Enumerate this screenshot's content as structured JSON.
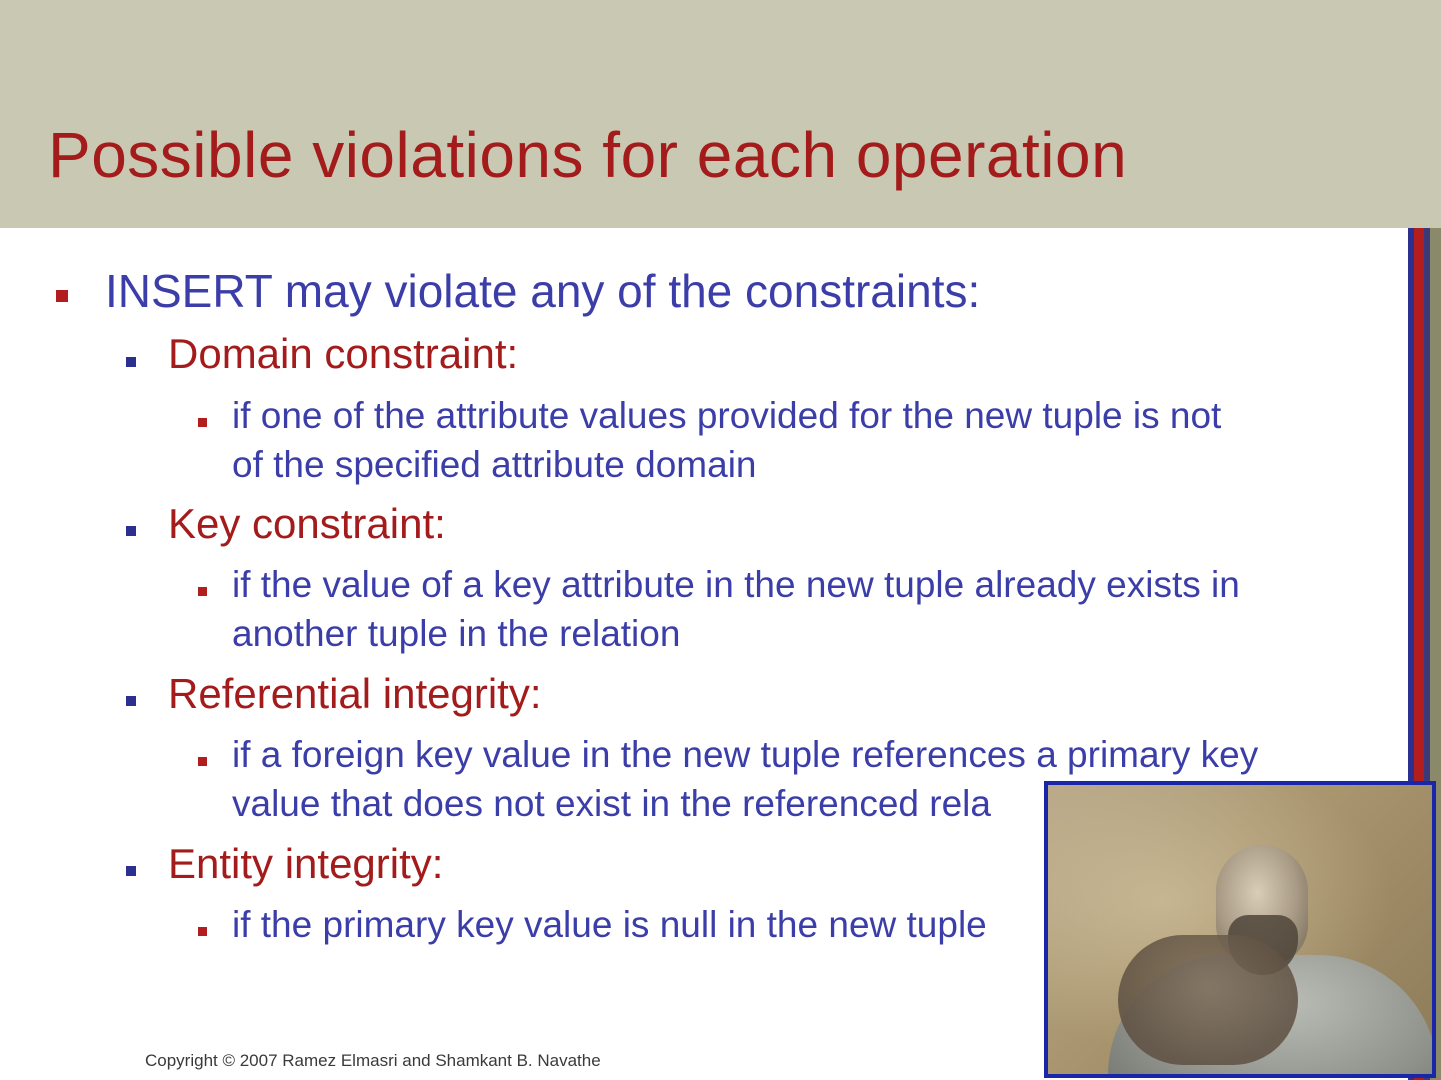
{
  "slide": {
    "title": "Possible violations for each operation",
    "bullets": {
      "main": "INSERT may violate any of the constraints:",
      "domain": {
        "heading": "Domain constraint:",
        "line1": "if one of the attribute values provided for the new tuple is not",
        "line2": "of the specified attribute domain"
      },
      "key": {
        "heading": "Key constraint:",
        "line1": "if the value of a key attribute in the new tuple already exists in",
        "line2": "another tuple in the relation"
      },
      "referential": {
        "heading": "Referential integrity:",
        "line1": "if a foreign key value in the new tuple references a primary key",
        "line2": "value that does not exist in the referenced rela"
      },
      "entity": {
        "heading": "Entity integrity:",
        "line1": "if the primary key value is null in the new tuple"
      }
    },
    "footer": {
      "copyright": "Copyright © 2007 Ramez Elmasri and Shamkant B. Navathe"
    }
  },
  "colors": {
    "title_band": "#c9c9b3",
    "title_text": "#a31b1b",
    "level1_text": "#3b3ea8",
    "level2_text": "#a31b1b",
    "level3_text": "#3b3ea8",
    "webcam_border": "#1a26a8"
  }
}
